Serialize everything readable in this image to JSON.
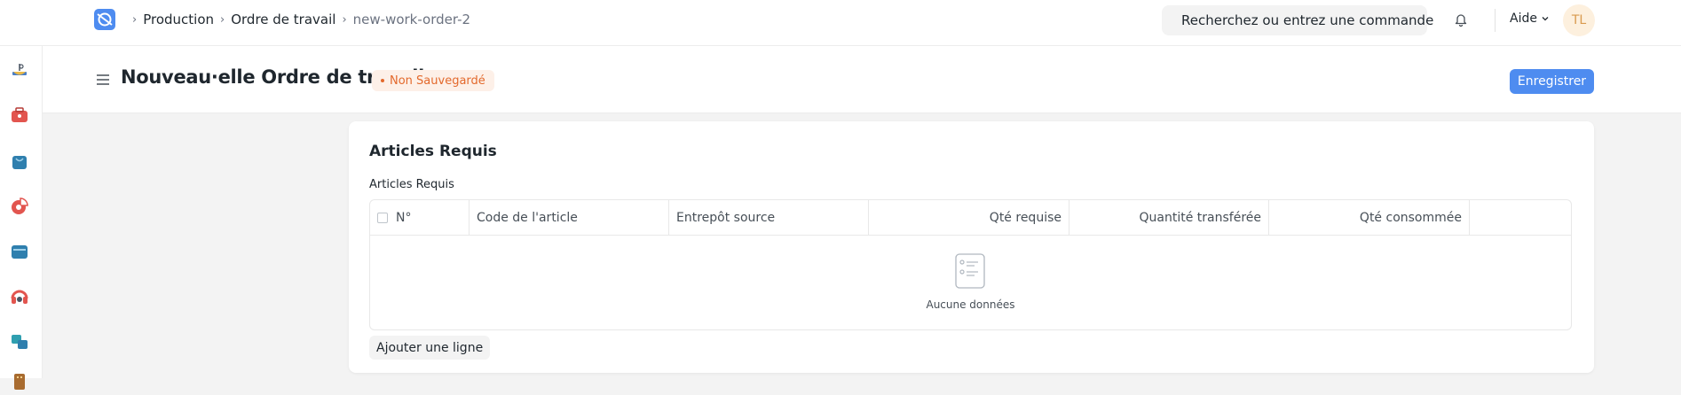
{
  "breadcrumb": {
    "items": [
      "Production",
      "Ordre de travail"
    ],
    "current": "new-work-order-2"
  },
  "search": {
    "placeholder": "Recherchez ou entrez une commande"
  },
  "help": {
    "label": "Aide"
  },
  "avatar": {
    "initials": "TL"
  },
  "page": {
    "title": "Nouveau·elle Ordre de travail",
    "status": "Non Sauvegardé",
    "save_label": "Enregistrer"
  },
  "section": {
    "title": "Articles Requis",
    "table_label": "Articles Requis",
    "columns": [
      "N°",
      "Code de l'article",
      "Entrepôt source",
      "Qté requise",
      "Quantité transférée",
      "Qté consommée"
    ],
    "empty_text": "Aucune données",
    "add_row_label": "Ajouter une ligne"
  },
  "colors": {
    "accent": "#4e8cf0",
    "status_orange": "#e3692c",
    "avatar_bg": "#fdf0de"
  },
  "sidebar_icons": [
    "mortar-board-icon",
    "toolbox-icon",
    "shopping-bag-icon",
    "pie-chart-icon",
    "folder-icon",
    "headset-icon",
    "stack-icon",
    "building-icon"
  ]
}
